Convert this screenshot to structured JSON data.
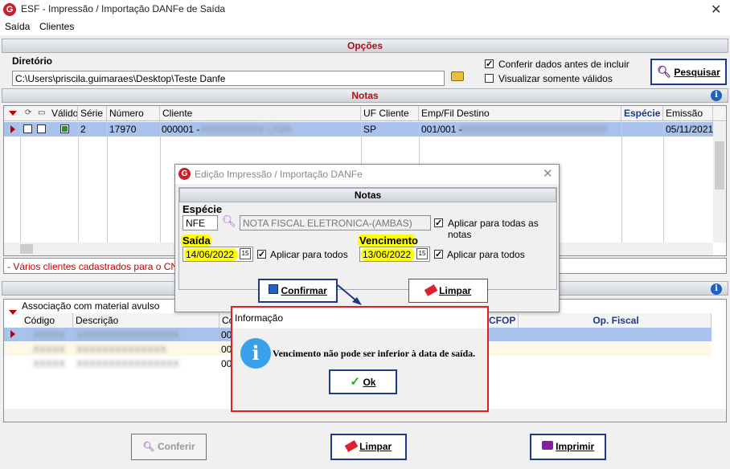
{
  "window": {
    "title": "ESF - Impressão / Importação DANFe de Saída"
  },
  "menu": [
    "Saída",
    "Clientes"
  ],
  "opcoes": {
    "header": "Opções",
    "diretorio_label": "Diretório",
    "diretorio_value": "C:\\Users\\priscila.guimaraes\\Desktop\\Teste Danfe",
    "conferir_label": "Conferir dados antes de incluir",
    "conferir_checked": true,
    "visualizar_label": "Visualizar somente válidos",
    "visualizar_checked": false,
    "pesquisar": "Pesquisar"
  },
  "notas": {
    "header": "Notas",
    "columns": [
      "Válido",
      "Série",
      "Número",
      "Cliente",
      "UF Cliente",
      "Emp/Fil Destino",
      "Espécie",
      "Emissão"
    ],
    "row": {
      "serie": "2",
      "numero": "17970",
      "cliente": "000001 - ",
      "cliente_blur": "XXXXXXXXXX LTDA",
      "uf": "SP",
      "emp": "001/001 - ",
      "emp_blur": "XXXXXXXXXXXXXXXXXXXXXXX",
      "emissao": "05/11/2021"
    },
    "status_msg": "- Vários clientes cadastrados para o CNPJ 5"
  },
  "assoc": {
    "label": "Associação com material avulso",
    "columns": [
      "Código",
      "Descrição",
      "Có"
    ],
    "extra_cols": [
      "CFOP",
      "Op. Fiscal"
    ],
    "rows": [
      {
        "codigo": "XXXXX",
        "descricao": "XXXXXXXXXXXXXXXX",
        "co": "00"
      },
      {
        "codigo": "XXXXX",
        "descricao": "XXXXXXXXXXXXXX",
        "co": "00"
      },
      {
        "codigo": "XXXXX",
        "descricao": "XXXXXXXXXXXXXXXX",
        "co": "00"
      }
    ]
  },
  "bottom": {
    "conferir": "Conferir",
    "limpar": "Limpar",
    "imprimir": "Imprimir"
  },
  "edit_dialog": {
    "title": "Edição Impressão / Importação DANFe",
    "header": "Notas",
    "especie_label": "Espécie",
    "especie_code": "NFE",
    "especie_desc": "NOTA FISCAL ELETRONICA-(AMBAS)",
    "aplicar_todas_notas": "Aplicar para todas as notas",
    "saida_label": "Saída",
    "saida_date": "14/06/2022",
    "aplicar_todos_1": "Aplicar para todos",
    "vencimento_label": "Vencimento",
    "vencimento_date": "13/06/2022",
    "aplicar_todos_2": "Aplicar para todos",
    "confirmar": "Confirmar",
    "limpar": "Limpar"
  },
  "info_dialog": {
    "title": "Informação",
    "message": "Vencimento não pode ser inferior à data de saída.",
    "ok": "Ok"
  },
  "colors": {
    "accent": "#b01010",
    "selection": "#a8c2ec",
    "highlight": "#ffff00"
  }
}
